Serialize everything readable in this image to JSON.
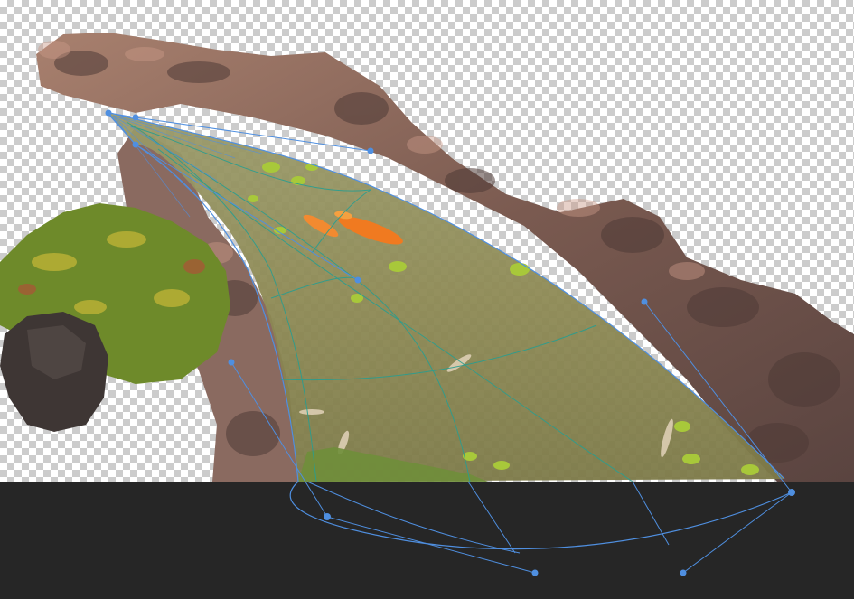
{
  "editor": {
    "tool": "warp",
    "canvas_background": "transparent-checkerboard",
    "pasteboard_color": "#262626",
    "handle_color": "#3b82f6",
    "mesh_line_color": "#4f8fe0",
    "grid_line_color": "#2a9d8f"
  },
  "layers": [
    {
      "name": "rocks",
      "color": "#8a6a5e"
    },
    {
      "name": "plants",
      "color": "#7a9a2e"
    },
    {
      "name": "water",
      "color": "#8f8a4a"
    },
    {
      "name": "koi",
      "color": "#f07a20"
    }
  ],
  "warp": {
    "anchor_count": 4,
    "handle_count": 8
  }
}
